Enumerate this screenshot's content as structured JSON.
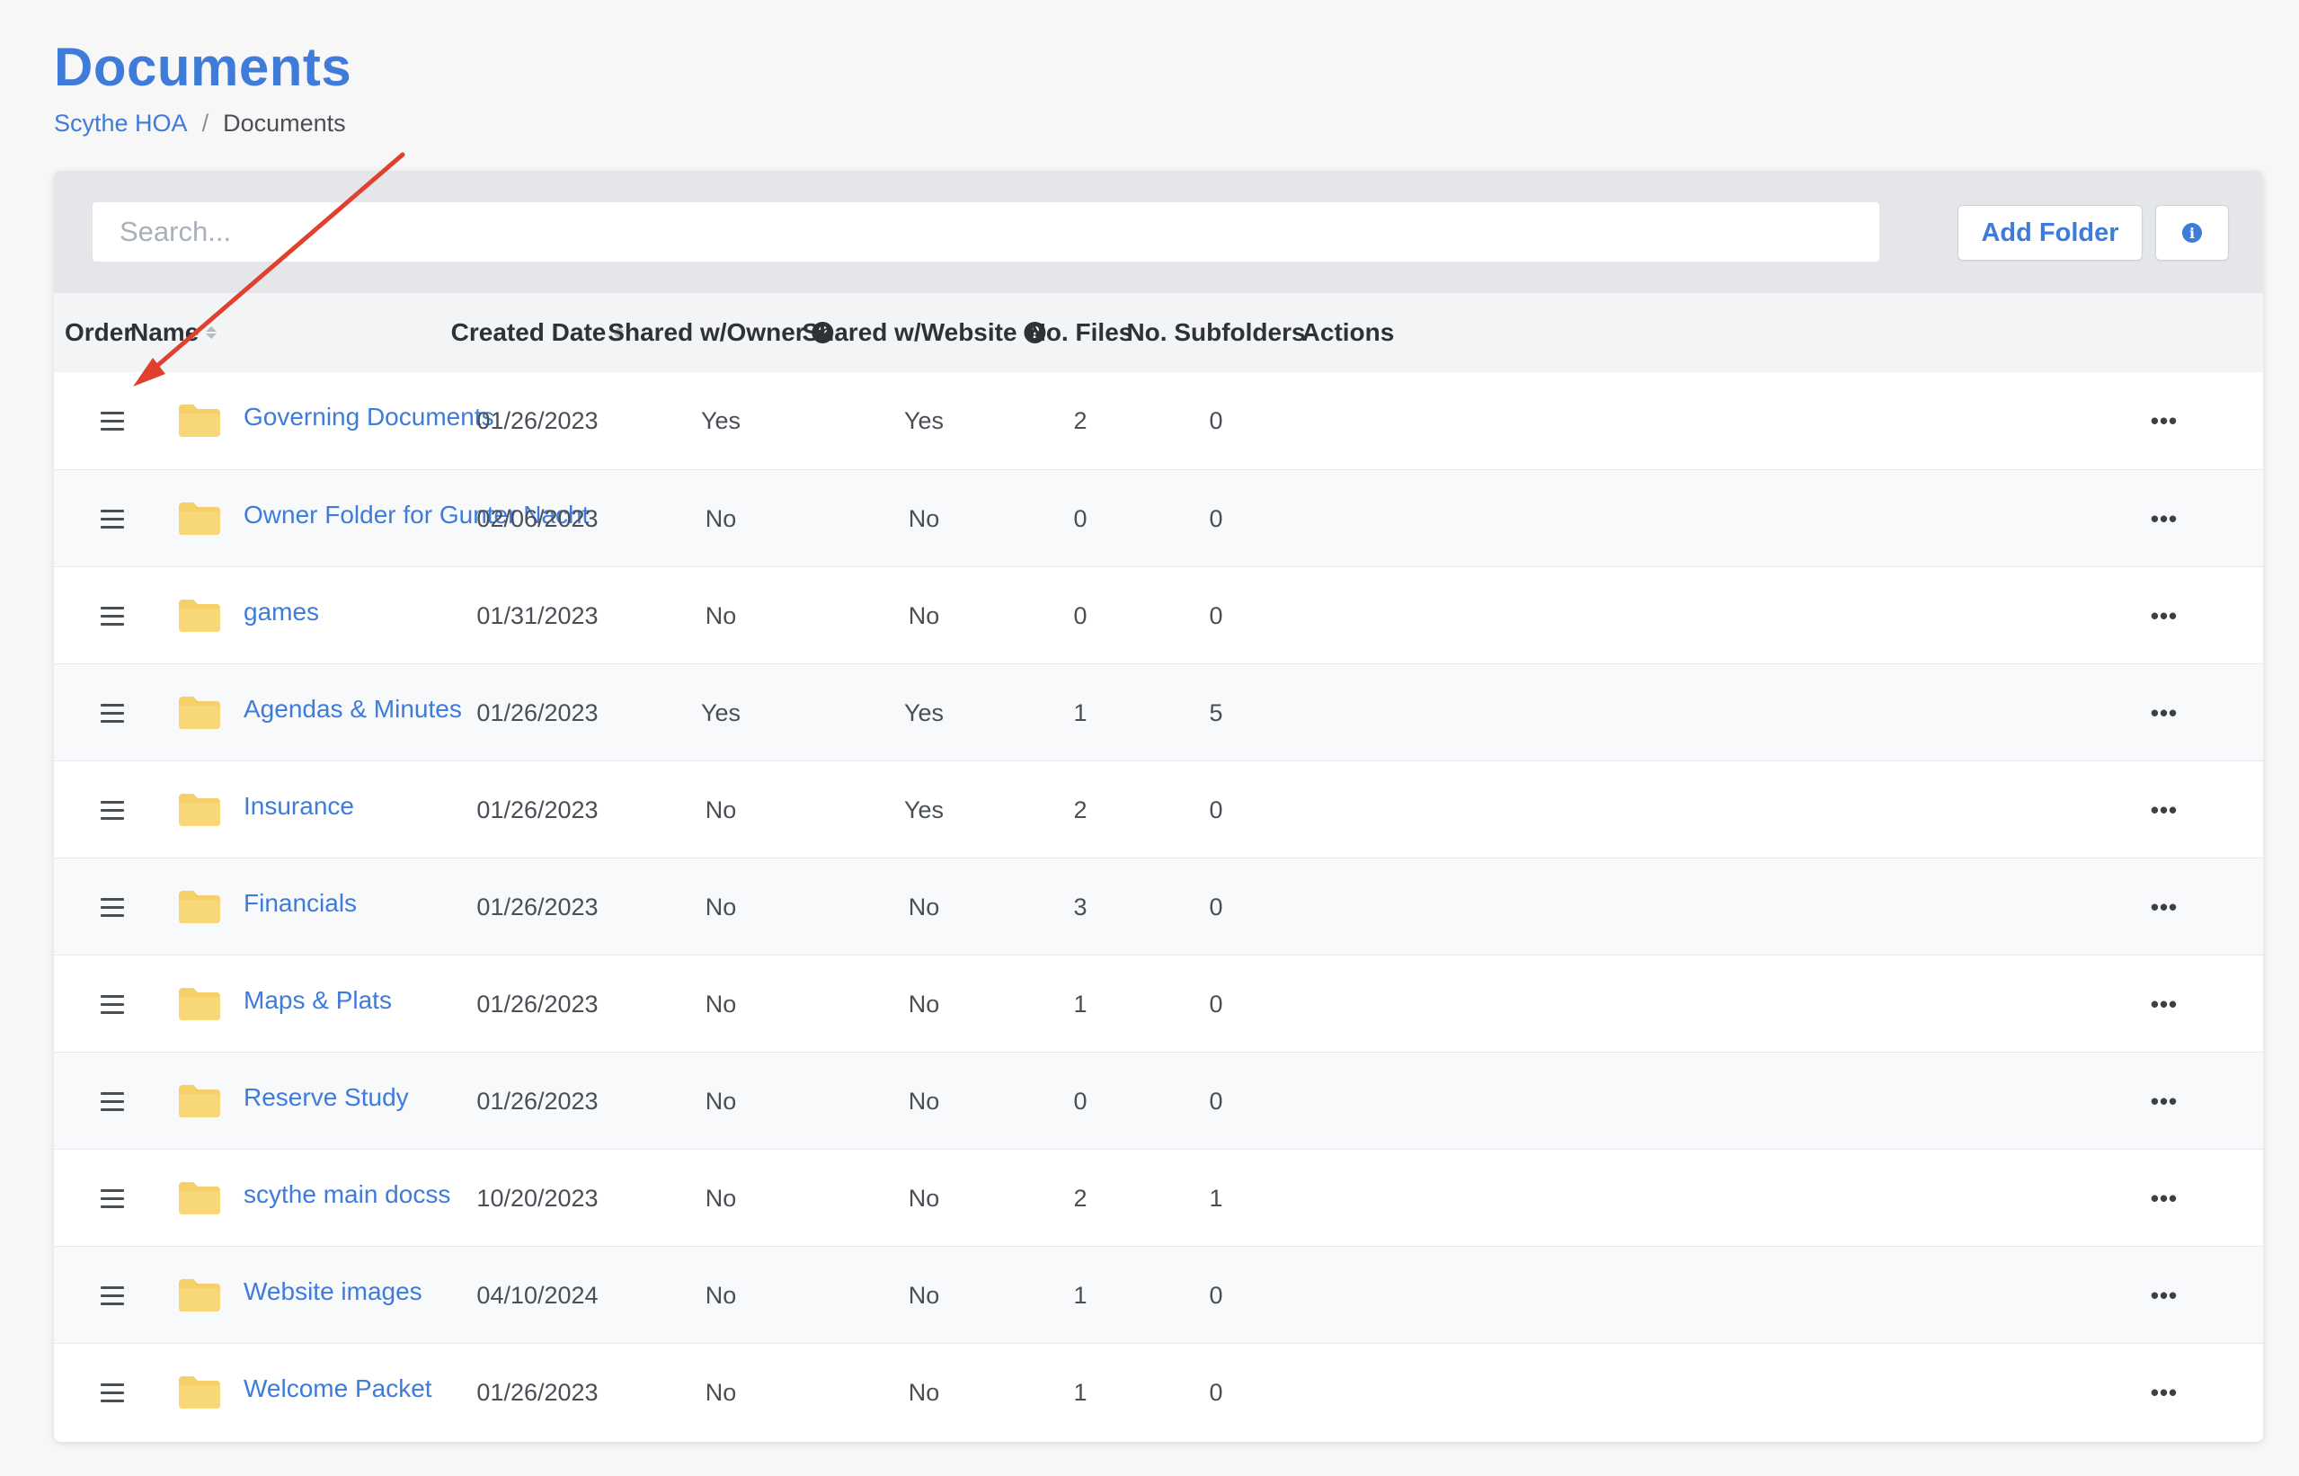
{
  "page": {
    "title": "Documents",
    "breadcrumb": {
      "root": "Scythe HOA",
      "separator": "/",
      "current": "Documents"
    }
  },
  "toolbar": {
    "search_placeholder": "Search...",
    "add_folder_label": "Add Folder",
    "info_icon": "info-icon",
    "info_glyph": "i"
  },
  "table": {
    "headers": {
      "order": "Order",
      "name": "Name",
      "created_date": "Created Date",
      "shared_owner": "Shared w/Owner",
      "shared_website": "Shared w/Website",
      "num_files": "No. Files",
      "num_subfolders": "No. Subfolders",
      "actions": "Actions"
    },
    "help_glyph": "?",
    "actions_glyph": "•••",
    "rows": [
      {
        "name": "Governing Documents",
        "created": "01/26/2023",
        "owner": "Yes",
        "website": "Yes",
        "files": "2",
        "subfolders": "0"
      },
      {
        "name": "Owner Folder for Gunter Nacht",
        "created": "02/06/2023",
        "owner": "No",
        "website": "No",
        "files": "0",
        "subfolders": "0"
      },
      {
        "name": "games",
        "created": "01/31/2023",
        "owner": "No",
        "website": "No",
        "files": "0",
        "subfolders": "0"
      },
      {
        "name": "Agendas & Minutes",
        "created": "01/26/2023",
        "owner": "Yes",
        "website": "Yes",
        "files": "1",
        "subfolders": "5"
      },
      {
        "name": "Insurance",
        "created": "01/26/2023",
        "owner": "No",
        "website": "Yes",
        "files": "2",
        "subfolders": "0"
      },
      {
        "name": "Financials",
        "created": "01/26/2023",
        "owner": "No",
        "website": "No",
        "files": "3",
        "subfolders": "0"
      },
      {
        "name": "Maps & Plats",
        "created": "01/26/2023",
        "owner": "No",
        "website": "No",
        "files": "1",
        "subfolders": "0"
      },
      {
        "name": "Reserve Study",
        "created": "01/26/2023",
        "owner": "No",
        "website": "No",
        "files": "0",
        "subfolders": "0"
      },
      {
        "name": "scythe main docss",
        "created": "10/20/2023",
        "owner": "No",
        "website": "No",
        "files": "2",
        "subfolders": "1"
      },
      {
        "name": "Website images",
        "created": "04/10/2024",
        "owner": "No",
        "website": "No",
        "files": "1",
        "subfolders": "0"
      },
      {
        "name": "Welcome Packet",
        "created": "01/26/2023",
        "owner": "No",
        "website": "No",
        "files": "1",
        "subfolders": "0"
      }
    ]
  },
  "colors": {
    "accent": "#3f7bd9",
    "folder": "#f5cf6a",
    "annotation_arrow": "#e0412f"
  }
}
